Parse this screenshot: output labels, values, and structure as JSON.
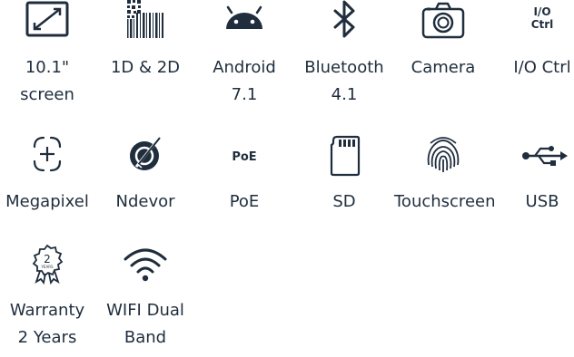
{
  "features": [
    {
      "icon": "screen-icon",
      "label": "10.1\"\nscreen"
    },
    {
      "icon": "barcode-icon",
      "label": "1D & 2D"
    },
    {
      "icon": "android-icon",
      "label": "Android\n7.1"
    },
    {
      "icon": "bluetooth-icon",
      "label": "Bluetooth\n4.1"
    },
    {
      "icon": "camera-icon",
      "label": "Camera"
    },
    {
      "icon": "io-ctrl-icon",
      "label": "I/O Ctrl",
      "icon_text": "I/O\nCtrl"
    },
    {
      "icon": "megapixel-icon",
      "label": "Megapixel"
    },
    {
      "icon": "ndevor-icon",
      "label": "Ndevor"
    },
    {
      "icon": "poe-icon",
      "label": "PoE",
      "icon_text": "PoE"
    },
    {
      "icon": "sd-card-icon",
      "label": "SD"
    },
    {
      "icon": "fingerprint-icon",
      "label": "Touchscreen"
    },
    {
      "icon": "usb-icon",
      "label": "USB"
    },
    {
      "icon": "warranty-icon",
      "label": "Warranty\n2 Years",
      "icon_text": "2",
      "icon_subtext": "YEARS"
    },
    {
      "icon": "wifi-icon",
      "label": "WIFI Dual\nBand"
    }
  ],
  "colors": {
    "icon": "#1f2d3d",
    "text": "#1f2d3d",
    "background": "#ffffff"
  }
}
